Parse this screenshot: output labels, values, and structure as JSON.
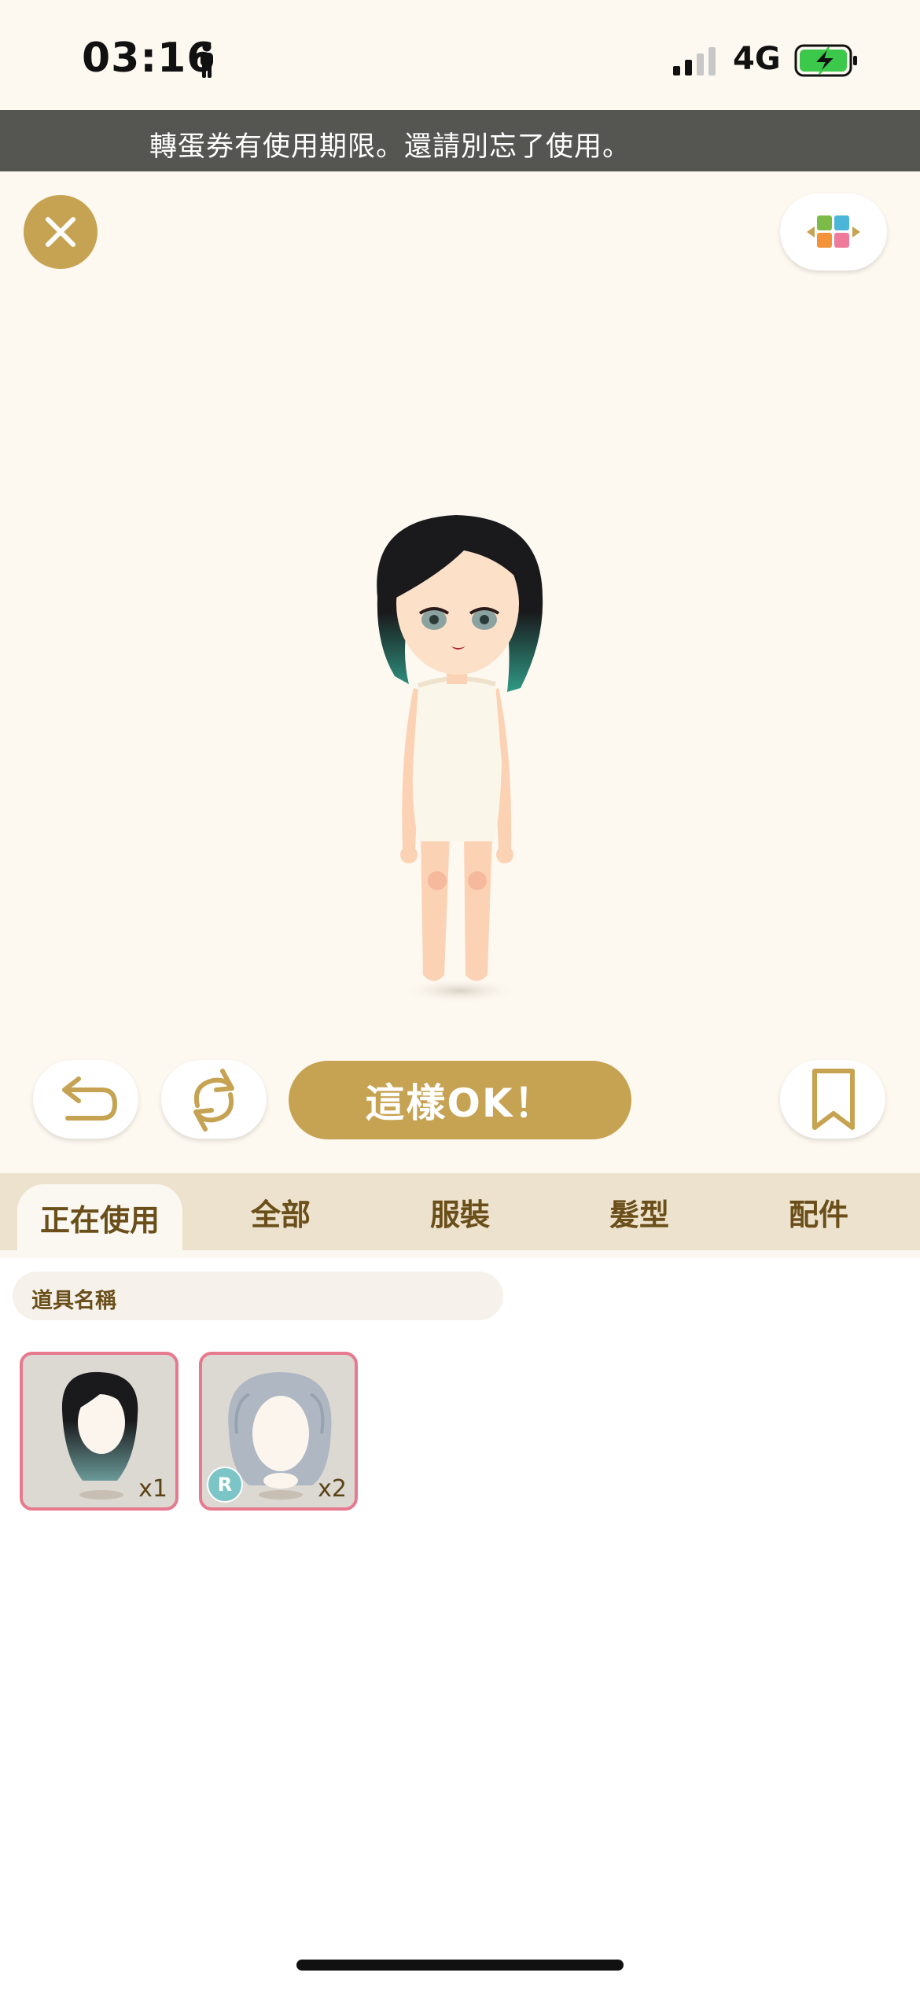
{
  "status_bar": {
    "time": "03:16",
    "network": "4G",
    "signal_bars_active": 2,
    "signal_bars_total": 4,
    "battery": "charging"
  },
  "notice": {
    "text": "轉蛋券有使用期限。還請別忘了使用。"
  },
  "toolbar": {
    "close_icon": "close-icon",
    "layout_icon": "color-grid-icon"
  },
  "actions": {
    "undo_icon": "undo-icon",
    "refresh_icon": "refresh-icon",
    "confirm_label": "這樣OK！",
    "bookmark_icon": "bookmark-icon"
  },
  "tabs": [
    {
      "label": "正在使用",
      "active": true
    },
    {
      "label": "全部",
      "active": false
    },
    {
      "label": "服裝",
      "active": false
    },
    {
      "label": "髮型",
      "active": false
    },
    {
      "label": "配件",
      "active": false
    }
  ],
  "search": {
    "placeholder": "道具名稱"
  },
  "items": [
    {
      "name": "black-green-hair",
      "count": "x1",
      "badge": ""
    },
    {
      "name": "silver-wavy-hair",
      "count": "x2",
      "badge": "R"
    }
  ],
  "colors": {
    "accent": "#c6a352",
    "item_border": "#e7798f",
    "rarity_badge": "#7bc5c7"
  }
}
